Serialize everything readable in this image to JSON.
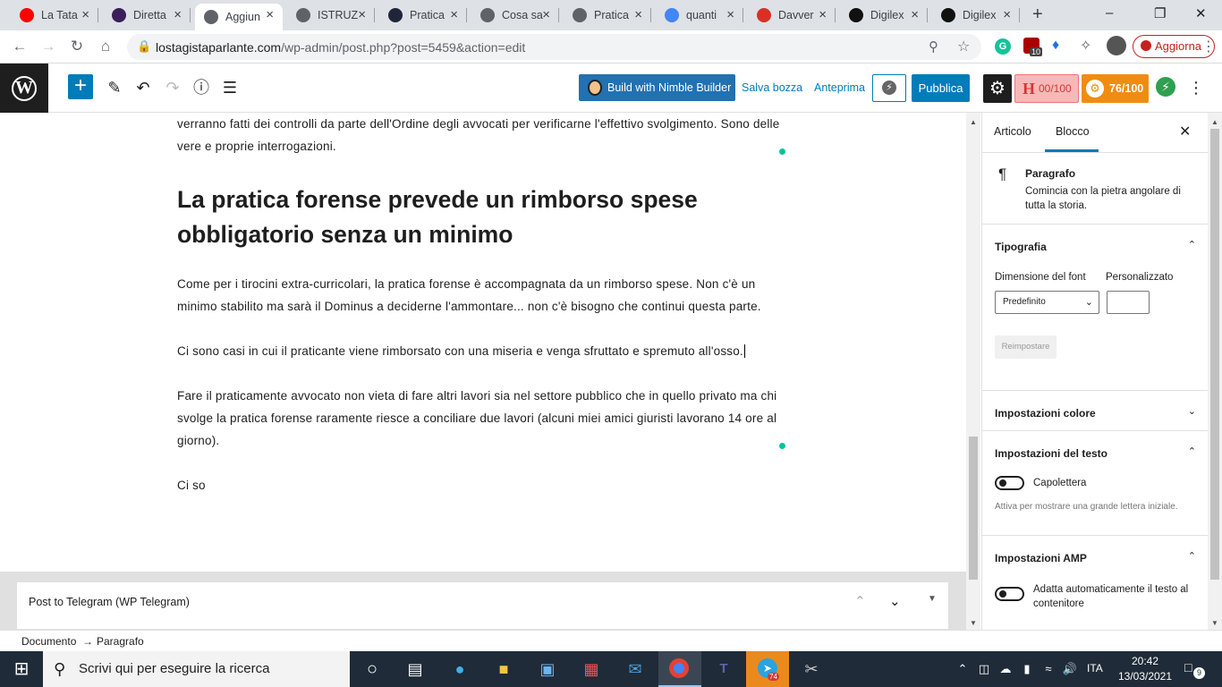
{
  "browser": {
    "tabs": [
      {
        "title": "La Tata",
        "favicon": "youtube-icon",
        "color": "#ff0000"
      },
      {
        "title": "Diretta",
        "favicon": "twitch-like-icon",
        "color": "#3a1f5a"
      },
      {
        "title": "Aggiun",
        "favicon": "globe-icon",
        "color": "#5f6368",
        "active": true
      },
      {
        "title": "ISTRUZ",
        "favicon": "globe-icon",
        "color": "#5f6368"
      },
      {
        "title": "Pratica",
        "favicon": "wordpress-icon",
        "color": "#21253a"
      },
      {
        "title": "Cosa sa",
        "favicon": "globe-icon",
        "color": "#5f6368"
      },
      {
        "title": "Pratica",
        "favicon": "globe-icon",
        "color": "#5f6368"
      },
      {
        "title": "quanti",
        "favicon": "google-icon",
        "color": "#4285f4"
      },
      {
        "title": "Davver",
        "favicon": "gmail-icon",
        "color": "#d93025"
      },
      {
        "title": "Digilex",
        "favicon": "digilex-icon",
        "color": "#111111"
      },
      {
        "title": "Digilex",
        "favicon": "digilex-icon",
        "color": "#111111"
      }
    ],
    "new_tab": "+",
    "url_domain": "lostagistaparlante.com",
    "url_path": "/wp-admin/post.php?post=5459&action=edit",
    "extension_badge": "10",
    "update_label": "Aggiorna"
  },
  "wp": {
    "nimble_label": "Build with Nimble Builder",
    "save_draft": "Salva bozza",
    "preview": "Anteprima",
    "publish": "Pubblica",
    "headline_score": "00/100",
    "headline_letter": "H",
    "rank_score": "76/100"
  },
  "editor": {
    "para_top": "verranno fatti dei controlli da parte dell'Ordine degli avvocati per verificarne l'effettivo svolgimento. Sono delle vere e proprie interrogazioni.",
    "heading": "La pratica forense prevede un rimborso spese obbligatorio senza un minimo",
    "para1": "Come per i tirocini extra-curricolari, la pratica forense è accompagnata da un rimborso spese. Non c'è un minimo stabilito ma sarà il Dominus a deciderne l'ammontare... non c'è bisogno che continui questa parte.",
    "para2": "Ci sono casi in cui il praticante viene rimborsato con una miseria e venga sfruttato e spremuto all'osso.",
    "para3": "Fare il praticamente avvocato non vieta di fare altri lavori sia nel settore pubblico che in quello privato ma chi svolge la pratica forense raramente riesce a conciliare due lavori (alcuni miei amici giuristi lavorano 14 ore al giorno).",
    "para4": "Ci so",
    "metabox_title": "Post to Telegram (WP Telegram)"
  },
  "sidebar": {
    "tab_post": "Articolo",
    "tab_block": "Blocco",
    "block_name": "Paragrafo",
    "block_desc": "Comincia con la pietra angolare di tutta la storia.",
    "typography": "Tipografia",
    "font_size_label": "Dimensione del font",
    "custom_label": "Personalizzato",
    "font_size_value": "Predefinito",
    "reset": "Reimpostare",
    "color_settings": "Impostazioni colore",
    "text_settings": "Impostazioni del testo",
    "dropcap": "Capolettera",
    "dropcap_help": "Attiva per mostrare una grande lettera iniziale.",
    "amp_settings": "Impostazioni AMP",
    "amp_fit": "Adatta automaticamente il testo al contenitore"
  },
  "footer": {
    "crumb_doc": "Documento",
    "crumb_arrow": "→",
    "crumb_block": "Paragrafo"
  },
  "taskbar": {
    "search_placeholder": "Scrivi qui per eseguire la ricerca",
    "telegram_badge": "74",
    "language": "ITA",
    "time": "20:42",
    "date": "13/03/2021",
    "notifications": "9"
  }
}
